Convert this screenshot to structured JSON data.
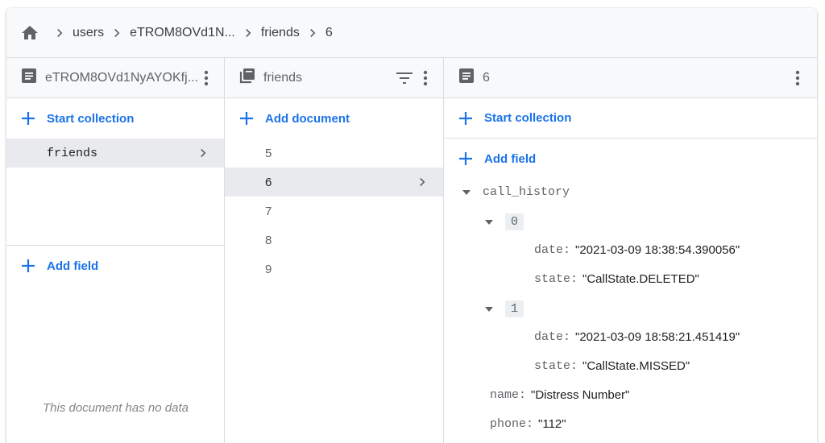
{
  "breadcrumb": {
    "items": [
      "users",
      "eTROM8OVd1N...",
      "friends",
      "6"
    ]
  },
  "panel_document": {
    "title": "eTROM8OVd1NyAYOKfj...",
    "start_collection": "Start collection",
    "collections": [
      "friends"
    ],
    "add_field": "Add field",
    "empty_text": "This document has no data"
  },
  "panel_collection": {
    "title": "friends",
    "add_document": "Add document",
    "documents": [
      "5",
      "6",
      "7",
      "8",
      "9"
    ]
  },
  "panel_fields": {
    "title": "6",
    "start_collection": "Start collection",
    "add_field": "Add field",
    "call_history_key": "call_history",
    "entries": [
      {
        "index": "0",
        "date_key": "date:",
        "date_val": "\"2021-03-09 18:38:54.390056\"",
        "state_key": "state:",
        "state_val": "\"CallState.DELETED\""
      },
      {
        "index": "1",
        "date_key": "date:",
        "date_val": "\"2021-03-09 18:58:21.451419\"",
        "state_key": "state:",
        "state_val": "\"CallState.MISSED\""
      }
    ],
    "name_key": "name:",
    "name_val": "\"Distress Number\"",
    "phone_key": "phone:",
    "phone_val": "\"112\""
  },
  "colors": {
    "accent": "#1a73e8",
    "selected_row": "#e8eaed",
    "header_bg": "#f8f9fa"
  }
}
